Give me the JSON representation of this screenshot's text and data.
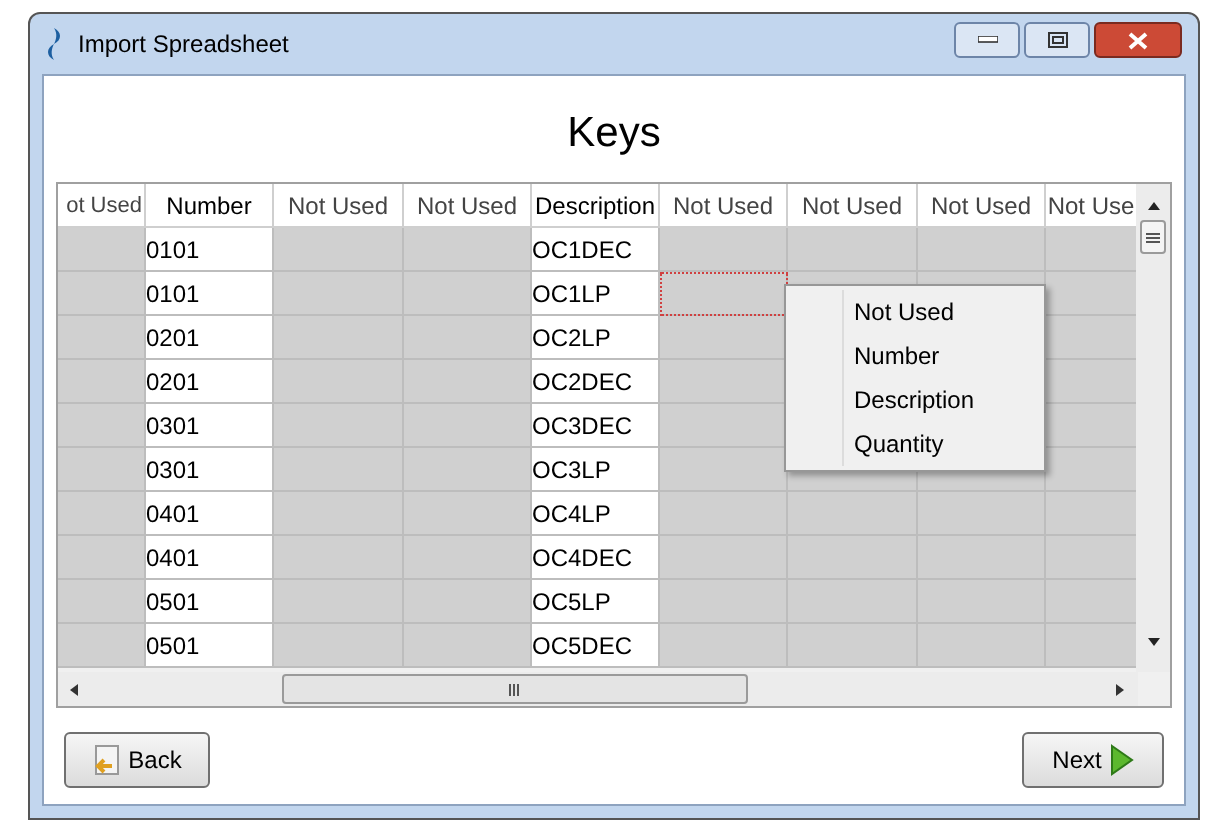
{
  "window": {
    "title": "Import Spreadsheet"
  },
  "heading": "Keys",
  "table": {
    "columns": [
      {
        "label": "ot Used",
        "mapped": false,
        "focused": false
      },
      {
        "label": "Number",
        "mapped": true,
        "focused": false
      },
      {
        "label": "Not Used",
        "mapped": false,
        "focused": false
      },
      {
        "label": "Not Used",
        "mapped": false,
        "focused": false
      },
      {
        "label": "Description",
        "mapped": true,
        "focused": false
      },
      {
        "label": "Not Used",
        "mapped": false,
        "focused": true
      },
      {
        "label": "Not Used",
        "mapped": false,
        "focused": false
      },
      {
        "label": "Not Used",
        "mapped": false,
        "focused": false
      },
      {
        "label": "Not Use",
        "mapped": false,
        "focused": false
      }
    ],
    "rows": [
      {
        "values": [
          "0101",
          "OC1DEC"
        ],
        "focused": false
      },
      {
        "values": [
          "0101",
          "OC1LP"
        ],
        "focused": true
      },
      {
        "values": [
          "0201",
          "OC2LP"
        ],
        "focused": false
      },
      {
        "values": [
          "0201",
          "OC2DEC"
        ],
        "focused": false
      },
      {
        "values": [
          "0301",
          "OC3DEC"
        ],
        "focused": false
      },
      {
        "values": [
          "0301",
          "OC3LP"
        ],
        "focused": false
      },
      {
        "values": [
          "0401",
          "OC4LP"
        ],
        "focused": false
      },
      {
        "values": [
          "0401",
          "OC4DEC"
        ],
        "focused": false
      },
      {
        "values": [
          "0501",
          "OC5LP"
        ],
        "focused": false
      },
      {
        "values": [
          "0501",
          "OC5DEC"
        ],
        "focused": false
      }
    ]
  },
  "context_menu": [
    "Not Used",
    "Number",
    "Description",
    "Quantity"
  ],
  "buttons": {
    "back": "Back",
    "next": "Next"
  }
}
